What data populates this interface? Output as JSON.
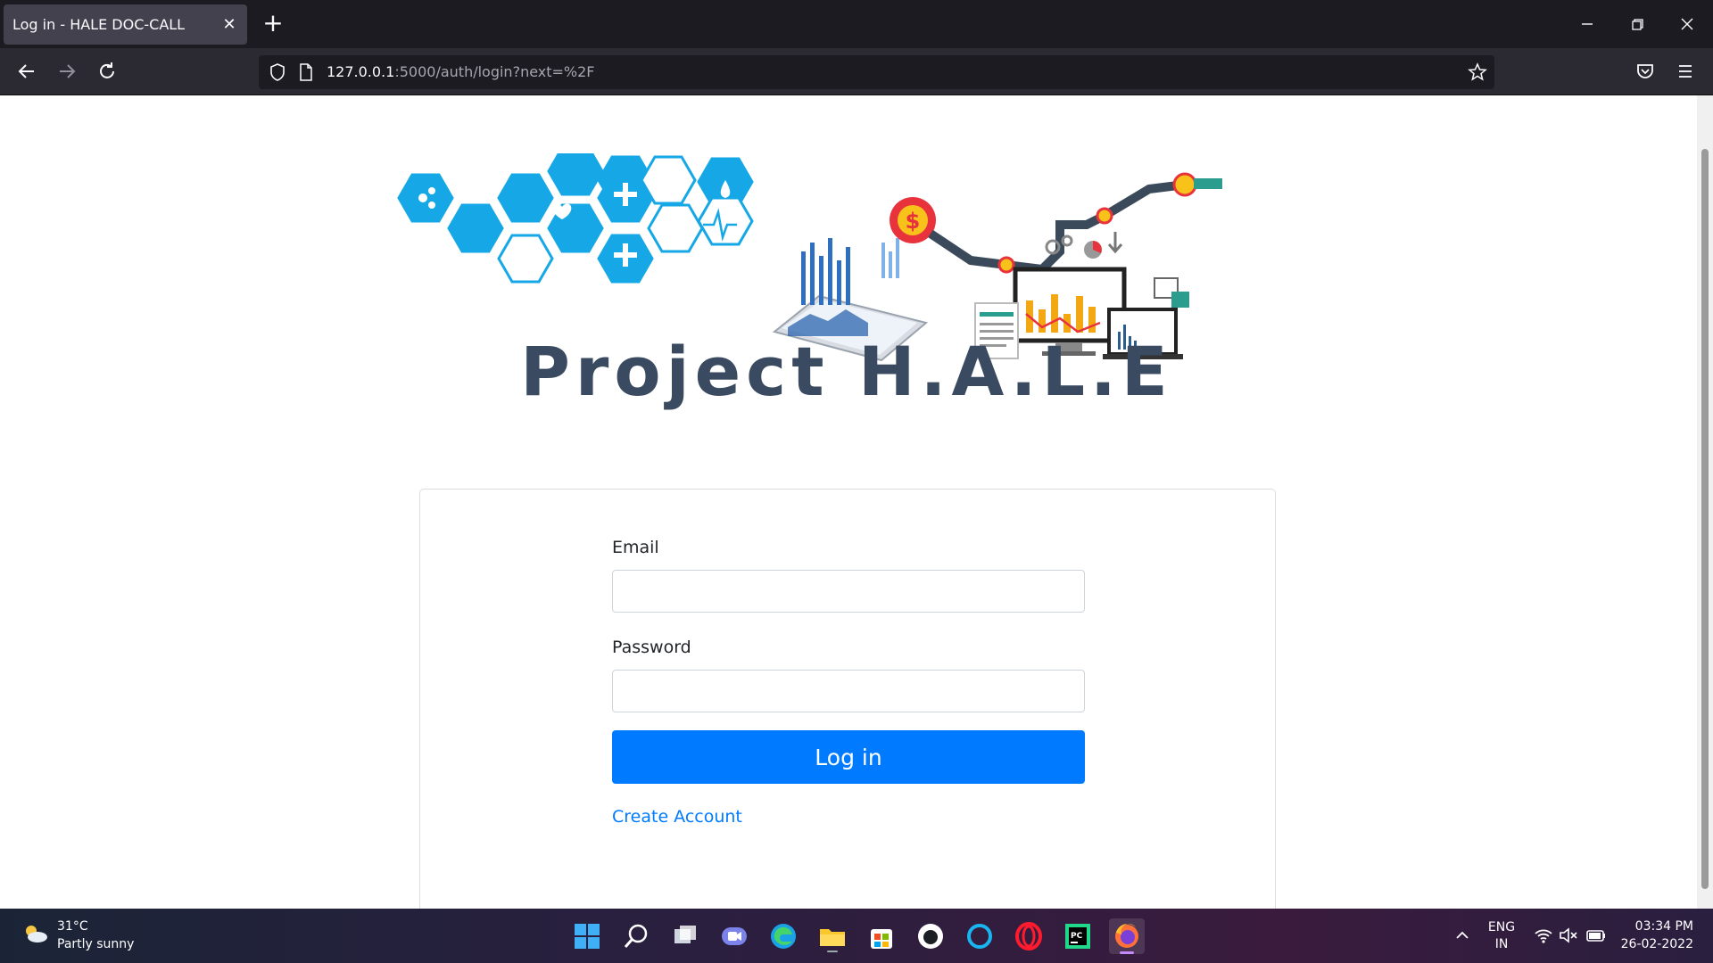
{
  "browser": {
    "tab_title": "Log in - HALE DOC-CALL",
    "url_host": "127.0.0.1",
    "url_rest": ":5000/auth/login?next=%2F"
  },
  "page": {
    "brand_title": "Project H.A.L.E",
    "form": {
      "email_label": "Email",
      "email_value": "",
      "password_label": "Password",
      "password_value": "",
      "submit_label": "Log in",
      "create_account_label": "Create Account"
    }
  },
  "taskbar": {
    "weather_temp": "31°C",
    "weather_desc": "Partly sunny",
    "lang_primary": "ENG",
    "lang_secondary": "IN",
    "time": "03:34 PM",
    "date": "26-02-2022"
  },
  "colors": {
    "primary_button": "#007bff",
    "link": "#007bff",
    "brand_text": "#3a4a60",
    "medical_hex": "#16a8e6"
  }
}
